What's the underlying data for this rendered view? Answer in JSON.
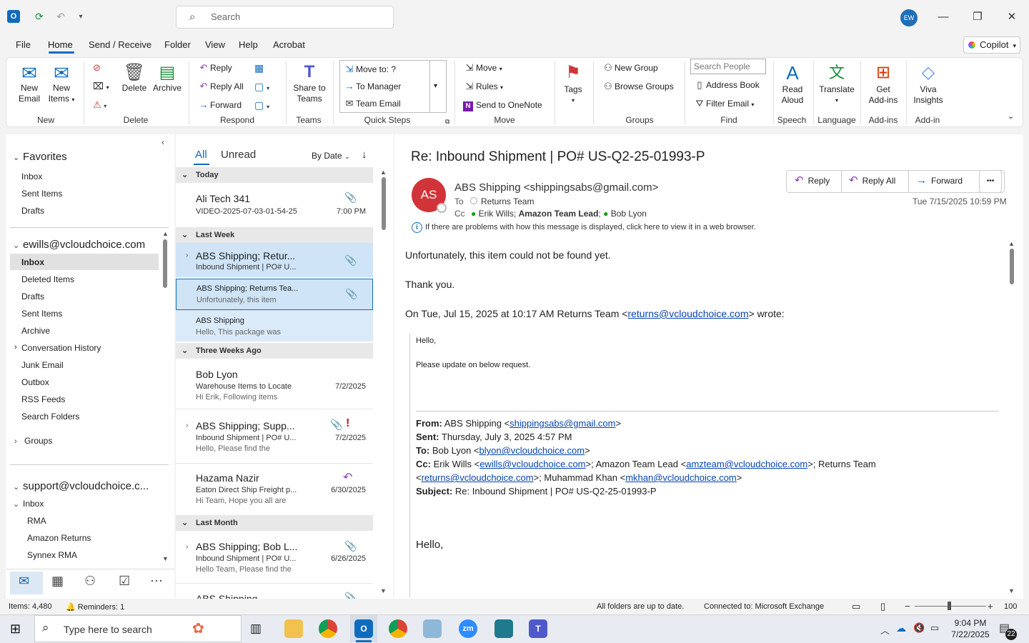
{
  "titlebar": {
    "search_placeholder": "Search",
    "avatar_initials": "EW",
    "min": "—",
    "max": "❐",
    "close": "✕"
  },
  "menu": [
    "File",
    "Home",
    "Send / Receive",
    "Folder",
    "View",
    "Help",
    "Acrobat"
  ],
  "copilot_label": "Copilot",
  "ribbon": {
    "new_email": [
      "New",
      "Email"
    ],
    "new_items": [
      "New",
      "Items"
    ],
    "delete": "Delete",
    "archive": "Archive",
    "reply": "Reply",
    "reply_all": "Reply All",
    "forward": "Forward",
    "share_teams": [
      "Share to",
      "Teams"
    ],
    "qs_move_to": "Move to: ?",
    "qs_to_manager": "To Manager",
    "qs_team_email": "Team Email",
    "move": "Move",
    "rules": "Rules",
    "send_onenote": "Send to OneNote",
    "tags": "Tags",
    "new_group": "New Group",
    "browse_groups": "Browse Groups",
    "search_people": "Search People",
    "address_book": "Address Book",
    "filter_email": "Filter Email",
    "read_aloud": [
      "Read",
      "Aloud"
    ],
    "translate": "Translate",
    "get_addins": [
      "Get",
      "Add-ins"
    ],
    "viva": [
      "Viva",
      "Insights"
    ],
    "groups": [
      "New",
      "Delete",
      "Respond",
      "Teams",
      "Quick Steps",
      "Move",
      "Groups",
      "Find",
      "Speech",
      "Language",
      "Add-ins",
      "Add-in"
    ]
  },
  "nav": {
    "favorites": "Favorites",
    "fav_items": [
      "Inbox",
      "Sent Items",
      "Drafts"
    ],
    "account1": "ewills@vcloudchoice.com",
    "account1_items": [
      "Inbox",
      "Deleted Items",
      "Drafts",
      "Sent Items",
      "Archive",
      "Conversation History",
      "Junk Email",
      "Outbox",
      "RSS Feeds",
      "Search Folders"
    ],
    "groups": "Groups",
    "account2": "support@vcloudchoice.c...",
    "account2_inbox": "Inbox",
    "account2_items": [
      "RMA",
      "Amazon Returns",
      "Synnex RMA"
    ]
  },
  "list": {
    "tab_all": "All",
    "tab_unread": "Unread",
    "sort": "By Date",
    "groups": [
      "Today",
      "Last Week",
      "Three Weeks Ago",
      "Last Month"
    ],
    "messages": [
      {
        "from": "Ali Tech 341",
        "subject": "VIDEO-2025-07-03-01-54-25",
        "preview": "",
        "date": "7:00 PM"
      },
      {
        "from": "ABS Shipping;  Retur...",
        "subject": "Inbound Shipment | PO# U...",
        "preview": "",
        "date": ""
      },
      {
        "from": "ABS Shipping;  Returns Tea...",
        "subject": "",
        "preview": "Unfortunately, this item",
        "date": ""
      },
      {
        "from": "ABS Shipping",
        "subject": "",
        "preview": "Hello,  This package was",
        "date": ""
      },
      {
        "from": "Bob Lyon",
        "subject": "Warehouse Items to Locate",
        "preview": "Hi Erik,  Following items",
        "date": "7/2/2025"
      },
      {
        "from": "ABS Shipping;  Supp...",
        "subject": "Inbound Shipment | PO# U...",
        "preview": "Hello,  Please find the",
        "date": "7/2/2025"
      },
      {
        "from": "Hazama Nazir",
        "subject": "Eaton Direct Ship Freight p...",
        "preview": "Hi Team,  Hope you all are",
        "date": "6/30/2025"
      },
      {
        "from": "ABS Shipping;  Bob L...",
        "subject": "Inbound Shipment | PO# U...",
        "preview": "Hello Team,  Please find the",
        "date": "6/26/2025"
      },
      {
        "from": "ABS Shipping",
        "subject": "",
        "preview": "",
        "date": ""
      }
    ],
    "important_mark": "!"
  },
  "reading": {
    "subject": "Re: Inbound Shipment | PO# US-Q2-25-01993-P",
    "sender_initials": "AS",
    "sender": "ABS Shipping <shippingsabs@gmail.com>",
    "to_label": "To",
    "to": "Returns Team",
    "cc_label": "Cc",
    "cc1": "Erik Wills;",
    "cc2": "Amazon Team Lead",
    "cc3": "Bob Lyon",
    "datetime": "Tue 7/15/2025 10:59 PM",
    "reply": "Reply",
    "reply_all": "Reply All",
    "forward": "Forward",
    "more": "•••",
    "info": "If there are problems with how this message is displayed, click here to view it in a web browser.",
    "body1": "Unfortunately, this item could not be found yet.",
    "body2": "Thank you.",
    "on_pre": "On Tue, Jul 15, 2025 at 10:17 AM Returns Team <",
    "on_link": "returns@vcloudchoice.com",
    "on_post": "> wrote:",
    "q_hello": "Hello,",
    "q_please": "Please update on below request.",
    "from_label": "From:",
    "from_pre": " ABS Shipping <",
    "from_link": "shippingsabs@gmail.com",
    "sent_label": "Sent:",
    "sent": " Thursday, July 3, 2025 4:57 PM",
    "to2_label": "To:",
    "to2_pre": " Bob Lyon <",
    "to2_link": "blyon@vcloudchoice.com",
    "cc2_label": "Cc:",
    "cc2_a": " Erik Wills <",
    "cc2_l1": "ewills@vcloudchoice.com",
    "cc2_b": ">; Amazon Team Lead <",
    "cc2_l2": "amzteam@vcloudchoice.com",
    "cc2_c": ">; Returns Team",
    "cc2_d": "<",
    "cc2_l3": "returns@vcloudchoice.com",
    "cc2_e": ">; Muhammad Khan <",
    "cc2_l4": "mkhan@vcloudchoice.com",
    "subj_label": "Subject:",
    "subj": " Re: Inbound Shipment | PO# US-Q2-25-01993-P",
    "hello2": "Hello,"
  },
  "status": {
    "items": "Items: 4,480",
    "reminders": "Reminders: 1",
    "folders": "All folders are up to date.",
    "connected": "Connected to: Microsoft Exchange",
    "zoom": "100"
  },
  "taskbar": {
    "search": "Type here to search",
    "time": "9:04 PM",
    "date": "7/22/2025",
    "notif": "22"
  }
}
